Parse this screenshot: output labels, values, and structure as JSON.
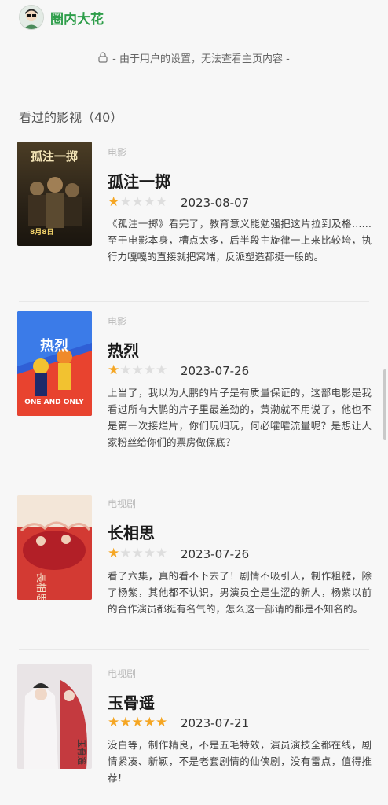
{
  "header": {
    "username": "圈内大花"
  },
  "notice": {
    "text": "- 由于用户的设置，无法查看主页内容 -"
  },
  "section": {
    "title": "看过的影视（40）"
  },
  "items": [
    {
      "type": "电影",
      "title": "孤注一掷",
      "rating": 1,
      "date": "2023-08-07",
      "review": "《孤注一掷》看完了，教育意义能勉强把这片拉到及格……至于电影本身，槽点太多，后半段主旋律一上来比较垮，执行力嘎嘎的直接就把窝端，反派塑造都挺一般的。",
      "poster_text": "孤注一掷",
      "poster_date": "8月8日",
      "poster_colors": [
        "#3a2f1e",
        "#6b5a3a",
        "#b89a5a"
      ]
    },
    {
      "type": "电影",
      "title": "热烈",
      "rating": 1,
      "date": "2023-07-26",
      "review": "上当了，我以为大鹏的片子是有质量保证的，这部电影是我看过所有大鹏的片子里最差劲的，黄渤就不用说了，他也不是第一次接烂片，你们玩归玩，何必嚯嚯流量呢？是想让人家粉丝给你们的票房做保底？",
      "poster_text": "热烈",
      "poster_sub": "ONE AND ONLY",
      "poster_colors": [
        "#2f5fd6",
        "#e8432f",
        "#f2c230"
      ]
    },
    {
      "type": "电视剧",
      "title": "长相思",
      "rating": 1,
      "date": "2023-07-26",
      "review": "看了六集，真的看不下去了！剧情不吸引人，制作粗糙，除了杨紫，其他都不认识，男演员全是生涩的新人，杨紫以前的合作演员都挺有名气的，怎么这一部请的都是不知名的。",
      "poster_text": "長相思",
      "poster_colors": [
        "#f3e6d8",
        "#c8262a",
        "#e8b9a0"
      ]
    },
    {
      "type": "电视剧",
      "title": "玉骨遥",
      "rating": 5,
      "date": "2023-07-21",
      "review": "没白等，制作精良，不是五毛特效，演员演技全都在线，剧情紧凑、新颖，不是老套剧情的仙侠剧，没有雷点，值得推荐！",
      "poster_text": "玉骨遥",
      "poster_colors": [
        "#e9e4e6",
        "#c43a3f",
        "#8a8d9a"
      ]
    }
  ],
  "colors": {
    "accent_green": "#2e9e4a",
    "star": "#f5a623"
  }
}
